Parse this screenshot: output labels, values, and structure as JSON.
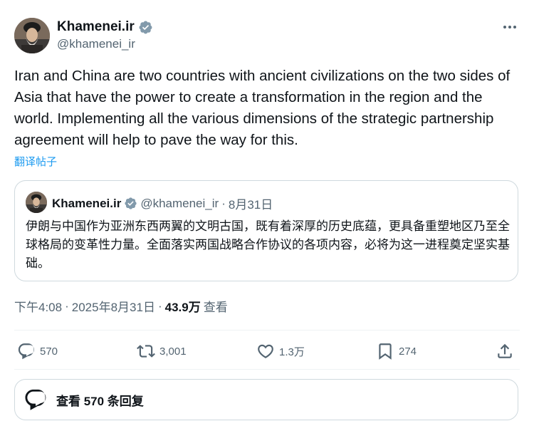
{
  "author": {
    "name": "Khamenei.ir",
    "handle": "@khamenei_ir",
    "verified": true,
    "badge_color": "#829aab"
  },
  "tweet": {
    "text": "Iran and China are two countries with ancient civilizations on the two sides of Asia that have the power to create a transformation in the region and the world. Implementing all the various dimensions of the strategic partnership agreement will help to pave the way for this.",
    "translate_label": "翻译帖子"
  },
  "quote": {
    "name": "Khamenei.ir",
    "handle": "@khamenei_ir",
    "separator": "·",
    "date": "8月31日",
    "text": "伊朗与中国作为亚洲东西两翼的文明古国，既有着深厚的历史底蕴，更具备重塑地区乃至全球格局的变革性力量。全面落实两国战略合作协议的各项内容，必将为这一进程奠定坚实基础。"
  },
  "meta": {
    "time": "下午4:08",
    "sep1": "·",
    "date": "2025年8月31日",
    "sep2": "·",
    "views": "43.9万",
    "views_label": "查看"
  },
  "actions": {
    "replies": "570",
    "reposts": "3,001",
    "likes": "1.3万",
    "bookmarks": "274"
  },
  "replies_button": {
    "label": "查看 570 条回复"
  },
  "colors": {
    "text": "#0f1419",
    "secondary": "#536471",
    "link": "#1d9bf0",
    "border": "#cfd9de",
    "divider": "#eff3f4"
  },
  "icons": [
    "more-icon",
    "verified-badge-icon",
    "reply-icon",
    "repost-icon",
    "like-icon",
    "bookmark-icon",
    "share-icon",
    "replies-bubble-icon"
  ]
}
